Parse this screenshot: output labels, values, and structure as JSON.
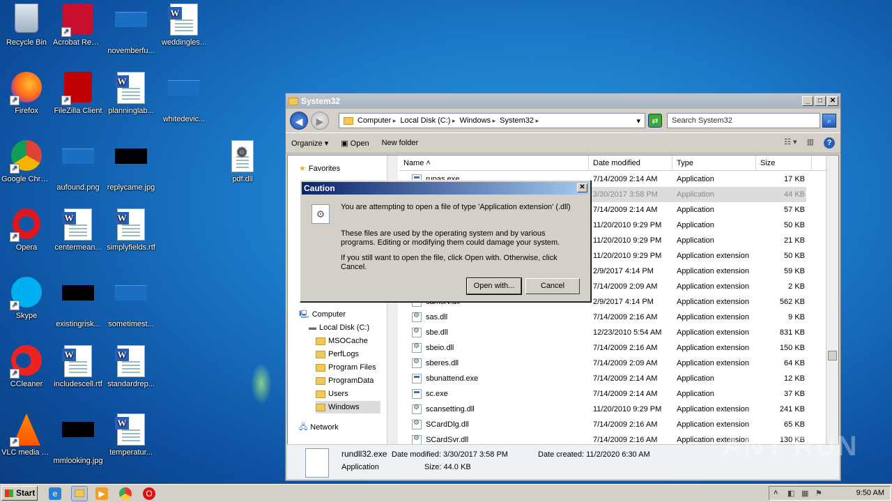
{
  "desktop": {
    "icons": [
      {
        "label": "Recycle Bin",
        "icon": "recycle-bin-icon"
      },
      {
        "label": "Acrobat Reader DC",
        "icon": "acrobat-icon"
      },
      {
        "label": "novemberfu...",
        "icon": "image-file-icon"
      },
      {
        "label": "weddingles...",
        "icon": "word-doc-icon"
      },
      {
        "label": "Firefox",
        "icon": "firefox-icon"
      },
      {
        "label": "FileZilla Client",
        "icon": "filezilla-icon"
      },
      {
        "label": "planninglab...",
        "icon": "word-doc-icon"
      },
      {
        "label": "whitedevic...",
        "icon": "image-file-icon"
      },
      {
        "label": "Google Chrome",
        "icon": "chrome-icon"
      },
      {
        "label": "aufound.png",
        "icon": "image-file-icon"
      },
      {
        "label": "replycame.jpg",
        "icon": "image-file-icon"
      },
      {
        "label": "pdf.dll",
        "icon": "dll-file-icon"
      },
      {
        "label": "Opera",
        "icon": "opera-icon"
      },
      {
        "label": "centermean...",
        "icon": "word-doc-icon"
      },
      {
        "label": "simplyfields.rtf",
        "icon": "word-doc-icon"
      },
      {
        "label": "Skype",
        "icon": "skype-icon"
      },
      {
        "label": "existingrisk...",
        "icon": "image-file-icon"
      },
      {
        "label": "sometimest...",
        "icon": "image-file-icon"
      },
      {
        "label": "CCleaner",
        "icon": "ccleaner-icon"
      },
      {
        "label": "includescell.rtf",
        "icon": "word-doc-icon"
      },
      {
        "label": "standardrep...",
        "icon": "word-doc-icon"
      },
      {
        "label": "VLC media player",
        "icon": "vlc-icon"
      },
      {
        "label": "mmlooking.jpg",
        "icon": "image-file-icon"
      },
      {
        "label": "temperatur...",
        "icon": "word-doc-icon"
      }
    ]
  },
  "window": {
    "title": "System32",
    "breadcrumbs": [
      "Computer",
      "Local Disk (C:)",
      "Windows",
      "System32"
    ],
    "search_placeholder": "Search System32",
    "toolbar": {
      "organize": "Organize",
      "open": "Open",
      "new_folder": "New folder"
    },
    "nav": {
      "favorites": "Favorites",
      "computer": "Computer",
      "local_disk": "Local Disk (C:)",
      "folders": [
        "MSOCache",
        "PerfLogs",
        "Program Files",
        "ProgramData",
        "Users",
        "Windows"
      ],
      "network": "Network"
    },
    "columns": {
      "name": "Name",
      "date": "Date modified",
      "type": "Type",
      "size": "Size"
    },
    "files": [
      {
        "name": "rupas.exe",
        "date": "7/14/2009 2:14 AM",
        "type": "Application",
        "size": "17 KB",
        "kind": "exe"
      },
      {
        "name": "rundll32.exe",
        "date": "3/30/2017 3:58 PM",
        "type": "Application",
        "size": "44 KB",
        "kind": "exe"
      },
      {
        "name": "",
        "date": "7/14/2009 2:14 AM",
        "type": "Application",
        "size": "57 KB",
        "kind": "exe"
      },
      {
        "name": "",
        "date": "11/20/2010 9:29 PM",
        "type": "Application",
        "size": "50 KB",
        "kind": "exe"
      },
      {
        "name": "",
        "date": "11/20/2010 9:29 PM",
        "type": "Application",
        "size": "21 KB",
        "kind": "exe"
      },
      {
        "name": "",
        "date": "11/20/2010 9:29 PM",
        "type": "Application extension",
        "size": "50 KB",
        "kind": "dll"
      },
      {
        "name": "",
        "date": "2/9/2017 4:14 PM",
        "type": "Application extension",
        "size": "59 KB",
        "kind": "dll"
      },
      {
        "name": "",
        "date": "7/14/2009 2:09 AM",
        "type": "Application extension",
        "size": "2 KB",
        "kind": "dll"
      },
      {
        "name": "samsrv.dll",
        "date": "2/9/2017 4:14 PM",
        "type": "Application extension",
        "size": "562 KB",
        "kind": "dll"
      },
      {
        "name": "sas.dll",
        "date": "7/14/2009 2:16 AM",
        "type": "Application extension",
        "size": "9 KB",
        "kind": "dll"
      },
      {
        "name": "sbe.dll",
        "date": "12/23/2010 5:54 AM",
        "type": "Application extension",
        "size": "831 KB",
        "kind": "dll"
      },
      {
        "name": "sbeio.dll",
        "date": "7/14/2009 2:16 AM",
        "type": "Application extension",
        "size": "150 KB",
        "kind": "dll"
      },
      {
        "name": "sberes.dll",
        "date": "7/14/2009 2:09 AM",
        "type": "Application extension",
        "size": "64 KB",
        "kind": "dll"
      },
      {
        "name": "sbunattend.exe",
        "date": "7/14/2009 2:14 AM",
        "type": "Application",
        "size": "12 KB",
        "kind": "exe"
      },
      {
        "name": "sc.exe",
        "date": "7/14/2009 2:14 AM",
        "type": "Application",
        "size": "37 KB",
        "kind": "exe"
      },
      {
        "name": "scansetting.dll",
        "date": "11/20/2010 9:29 PM",
        "type": "Application extension",
        "size": "241 KB",
        "kind": "dll"
      },
      {
        "name": "SCardDlg.dll",
        "date": "7/14/2009 2:16 AM",
        "type": "Application extension",
        "size": "65 KB",
        "kind": "dll"
      },
      {
        "name": "SCardSvr.dll",
        "date": "7/14/2009 2:16 AM",
        "type": "Application extension",
        "size": "130 KB",
        "kind": "dll"
      }
    ],
    "details": {
      "name": "rundll32.exe",
      "type": "Application",
      "modified": "Date modified: 3/30/2017 3:58 PM",
      "size": "Size: 44.0 KB",
      "created": "Date created: 11/2/2020 6:30 AM"
    }
  },
  "dialog": {
    "title": "Caution",
    "line1": "You are attempting to open a file of type 'Application extension' (.dll)",
    "line2": "These files are used by the operating system and by various programs. Editing or modifying them could damage your system.",
    "line3": "If you still want to open the file, click Open with. Otherwise, click Cancel.",
    "open_with": "Open with...",
    "cancel": "Cancel"
  },
  "taskbar": {
    "start": "Start",
    "clock": "9:50 AM"
  },
  "watermark": "ANY RUN"
}
